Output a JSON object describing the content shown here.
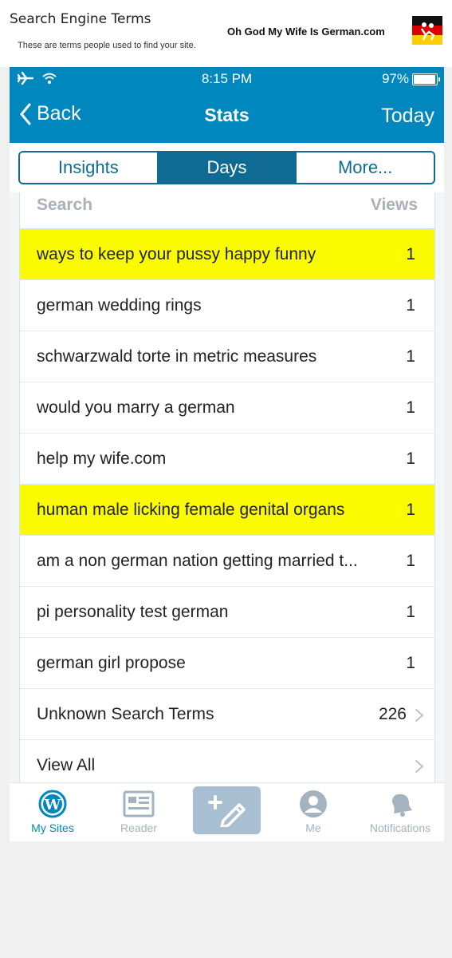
{
  "header": {
    "title": "Search Engine Terms",
    "subtitle": "These are terms people used to find your site.",
    "brand": "Oh God My Wife Is German.com"
  },
  "status_bar": {
    "time": "8:15 PM",
    "battery": "97%",
    "battery_level": 0.97,
    "icons": [
      "airplane-icon",
      "wifi-icon",
      "battery-icon"
    ]
  },
  "nav": {
    "back_label": "Back",
    "title": "Stats",
    "right_label": "Today"
  },
  "segments": [
    {
      "label": "Insights",
      "active": false
    },
    {
      "label": "Days",
      "active": true
    },
    {
      "label": "More..."
    }
  ],
  "table": {
    "col_search": "Search",
    "col_views": "Views",
    "rows": [
      {
        "term": "ways to keep your pussy happy funny",
        "views": "1",
        "highlight": true
      },
      {
        "term": "german wedding rings",
        "views": "1"
      },
      {
        "term": "schwarzwald torte in metric measures",
        "views": "1"
      },
      {
        "term": "would you marry a german",
        "views": "1"
      },
      {
        "term": "help my wife.com",
        "views": "1"
      },
      {
        "term": "human male licking female genital organs",
        "views": "1",
        "highlight": true
      },
      {
        "term": "am a non german nation getting married t...",
        "views": "1"
      },
      {
        "term": "pi personality test german",
        "views": "1"
      },
      {
        "term": "german girl propose",
        "views": "1"
      },
      {
        "term": "Unknown Search Terms",
        "views": "226",
        "chevron": true
      },
      {
        "term": "View All",
        "views": "",
        "chevron": true
      }
    ]
  },
  "tab_bar": {
    "items": [
      {
        "label": "My Sites",
        "icon": "wordpress-icon",
        "active": true
      },
      {
        "label": "Reader",
        "icon": "reader-icon"
      },
      {
        "label": "",
        "icon": "write-icon"
      },
      {
        "label": "Me",
        "icon": "user-icon"
      },
      {
        "label": "Notifications",
        "icon": "bell-icon"
      }
    ]
  },
  "colors": {
    "wp_blue": "#0087be",
    "segment_blue": "#0f6b93",
    "highlight_yellow": "#fbfb00",
    "tab_gray": "#a3b3c0"
  }
}
